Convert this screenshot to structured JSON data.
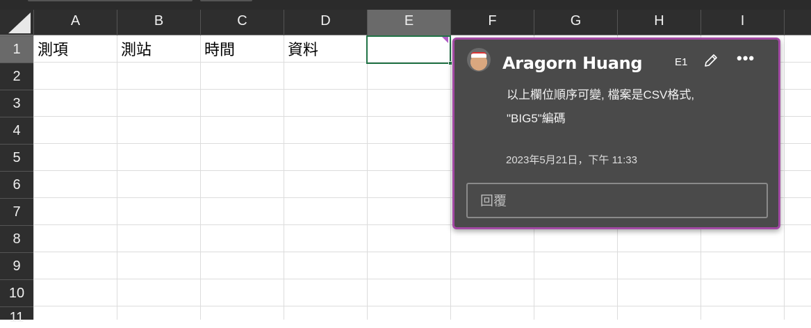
{
  "columns": [
    "A",
    "B",
    "C",
    "D",
    "E",
    "F",
    "G",
    "H",
    "I"
  ],
  "rows": [
    "1",
    "2",
    "3",
    "4",
    "5",
    "6",
    "7",
    "8",
    "9",
    "10",
    "11"
  ],
  "selected_cell": "E1",
  "cells": {
    "A1": "測項",
    "B1": "測站",
    "C1": "時間",
    "D1": "資料"
  },
  "comment": {
    "author": "Aragorn Huang",
    "cell_ref": "E1",
    "line1": "以上欄位順序可變, 檔案是CSV格式,",
    "line2": "\"BIG5\"編碼",
    "timestamp": "2023年5月21日，下午 11:33",
    "reply_placeholder": "回覆",
    "more_label": "•••",
    "accent": "#a349a4"
  }
}
